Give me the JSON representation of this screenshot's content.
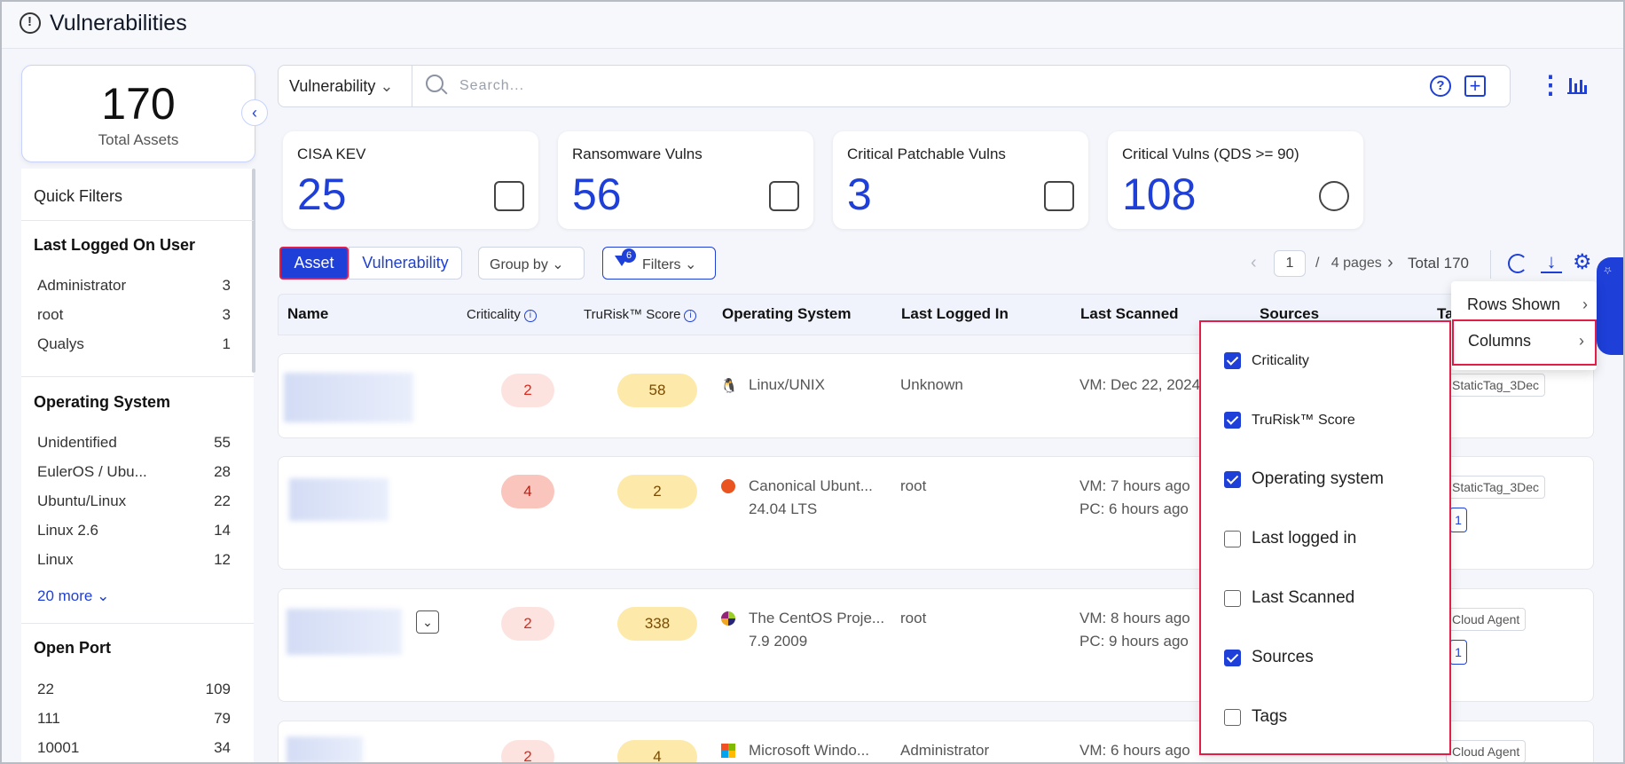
{
  "page": {
    "title": "Vulnerabilities"
  },
  "summary": {
    "total_value": "170",
    "total_label": "Total Assets"
  },
  "sidebar": {
    "quick_filters": "Quick Filters",
    "sections": [
      {
        "title": "Last Logged On User",
        "items": [
          {
            "label": "Administrator",
            "count": "3"
          },
          {
            "label": "root",
            "count": "3"
          },
          {
            "label": "Qualys",
            "count": "1"
          }
        ]
      },
      {
        "title": "Operating System",
        "items": [
          {
            "label": "Unidentified",
            "count": "55"
          },
          {
            "label": "EulerOS / Ubu...",
            "count": "28"
          },
          {
            "label": "Ubuntu/Linux",
            "count": "22"
          },
          {
            "label": "Linux 2.6",
            "count": "14"
          },
          {
            "label": "Linux",
            "count": "12"
          }
        ],
        "more": "20 more"
      },
      {
        "title": "Open Port",
        "items": [
          {
            "label": "22",
            "count": "109"
          },
          {
            "label": "111",
            "count": "79"
          },
          {
            "label": "10001",
            "count": "34"
          }
        ]
      }
    ]
  },
  "search": {
    "scope": "Vulnerability",
    "placeholder": "Search..."
  },
  "cards": [
    {
      "label": "CISA KEV",
      "value": "25",
      "icon": "gauge-icon"
    },
    {
      "label": "Ransomware Vulns",
      "value": "56",
      "icon": "speedometer-icon"
    },
    {
      "label": "Critical Patchable Vulns",
      "value": "3",
      "icon": "package-user-icon"
    },
    {
      "label": "Critical Vulns (QDS >= 90)",
      "value": "108",
      "icon": "clock-search-icon"
    }
  ],
  "toolbar": {
    "tab_asset": "Asset",
    "tab_vulnerability": "Vulnerability",
    "group_by": "Group by",
    "filters": "Filters",
    "filters_count": "6",
    "page_current": "1",
    "page_sep": "/",
    "pages": "4 pages",
    "total": "Total 170"
  },
  "table": {
    "headers": {
      "name": "Name",
      "criticality": "Criticality",
      "trurisk": "TruRisk™ Score",
      "os": "Operating System",
      "last_logged": "Last Logged In",
      "last_scanned": "Last Scanned",
      "sources": "Sources",
      "tags": "Ta"
    },
    "rows": [
      {
        "criticality": "2",
        "score": "58",
        "os_line1": "Linux/UNIX",
        "os_line2": "",
        "logged": "Unknown",
        "scan1": "VM: Dec 22, 2024",
        "scan2": "",
        "tag": "StaticTag_3Dec",
        "tag_count": ""
      },
      {
        "criticality": "4",
        "score": "2",
        "os_line1": "Canonical Ubunt...",
        "os_line2": "24.04 LTS",
        "logged": "root",
        "scan1": "VM: 7 hours ago",
        "scan2": "PC: 6 hours ago",
        "tag": "StaticTag_3Dec",
        "tag_count": "1"
      },
      {
        "criticality": "2",
        "score": "338",
        "os_line1": "The CentOS Proje...",
        "os_line2": "7.9 2009",
        "logged": "root",
        "scan1": "VM: 8 hours ago",
        "scan2": "PC: 9 hours ago",
        "tag": "Cloud Agent",
        "tag_count": "1"
      },
      {
        "criticality": "2",
        "score": "4",
        "os_line1": "Microsoft Windo...",
        "os_line2": "",
        "logged": "Administrator",
        "scan1": "VM: 6 hours ago",
        "scan2": "",
        "tag": "Cloud Agent",
        "tag_count": ""
      }
    ]
  },
  "menu": {
    "rows_shown": "Rows Shown",
    "columns": "Columns"
  },
  "columns_panel": [
    {
      "label": "Criticality",
      "checked": true
    },
    {
      "label": "TruRisk™ Score",
      "checked": true
    },
    {
      "label": "Operating system",
      "checked": true
    },
    {
      "label": "Last logged in",
      "checked": false
    },
    {
      "label": "Last Scanned",
      "checked": false
    },
    {
      "label": "Sources",
      "checked": true
    },
    {
      "label": "Tags",
      "checked": false
    }
  ],
  "colors": {
    "accent": "#1e3fd8",
    "highlight": "#e11d48",
    "crit_bg": "#fde3df",
    "score_bg": "#fde9a9"
  }
}
